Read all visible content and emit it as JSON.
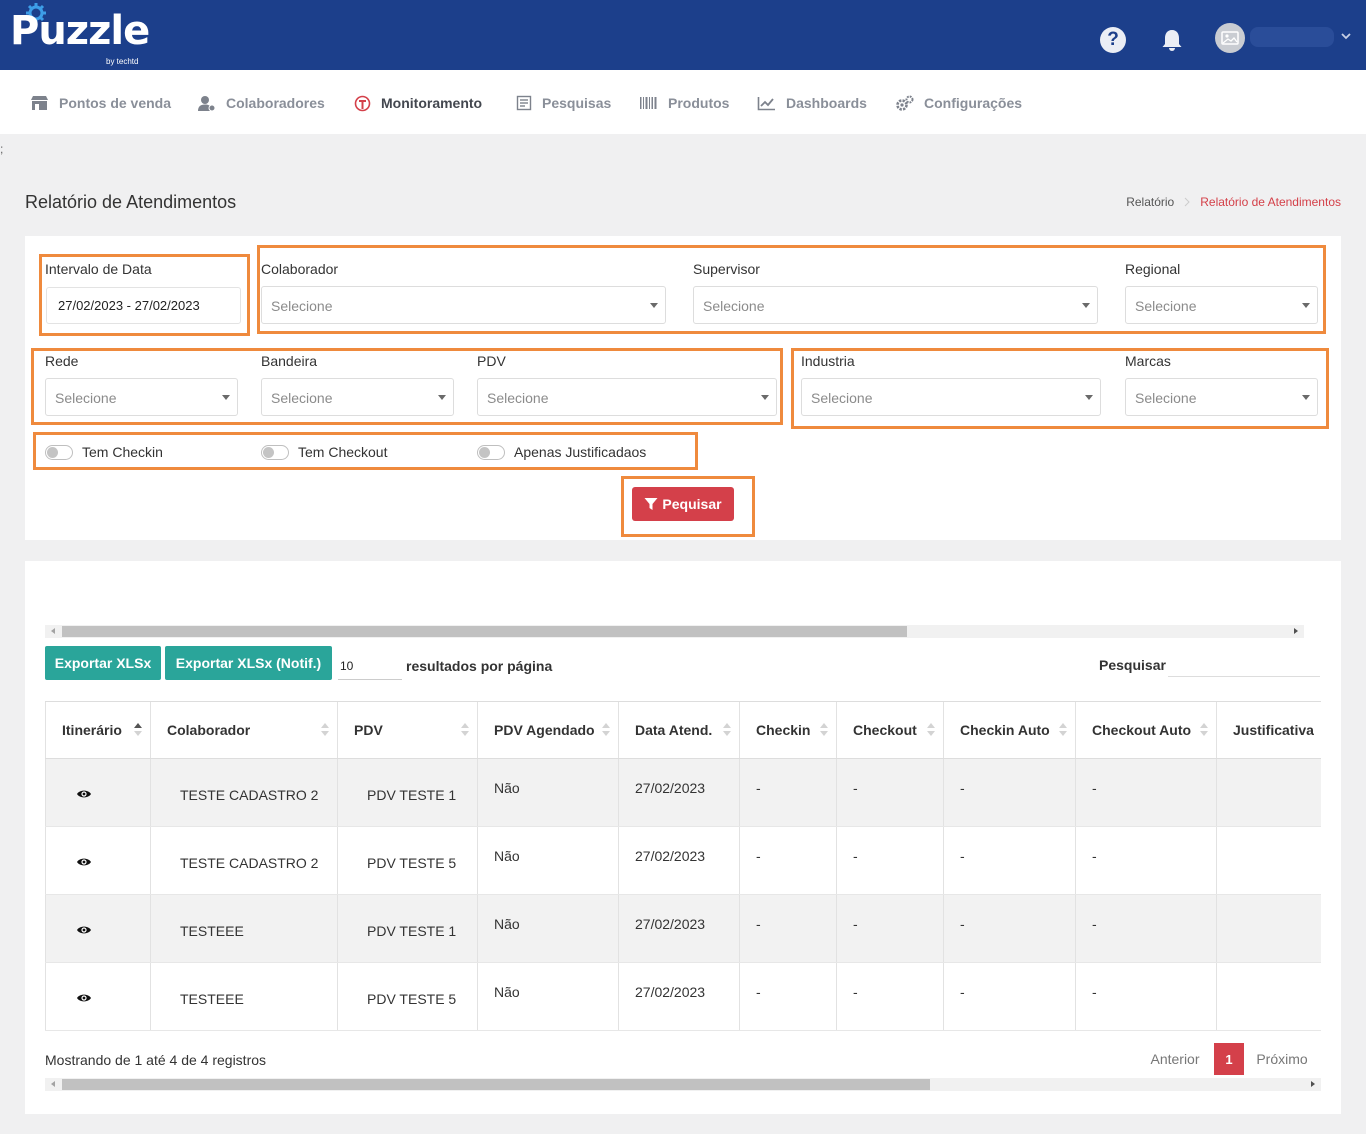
{
  "header": {
    "logo_text": "Puzzle",
    "logo_sub": "by techtd",
    "help_glyph": "?"
  },
  "nav": {
    "items": [
      {
        "label": "Pontos de venda",
        "icon": "store-icon"
      },
      {
        "label": "Colaboradores",
        "icon": "users-gear-icon"
      },
      {
        "label": "Monitoramento",
        "icon": "monitor-pin-icon",
        "active": true
      },
      {
        "label": "Pesquisas",
        "icon": "survey-icon"
      },
      {
        "label": "Produtos",
        "icon": "barcode-icon"
      },
      {
        "label": "Dashboards",
        "icon": "chart-line-icon"
      },
      {
        "label": "Configurações",
        "icon": "gears-icon"
      }
    ]
  },
  "stray_char": ";",
  "page": {
    "title": "Relatório de Atendimentos",
    "breadcrumb": [
      "Relatório",
      "Relatório de Atendimentos"
    ]
  },
  "filters": {
    "date_label": "Intervalo de Data",
    "date_value": "27/02/2023 - 27/02/2023",
    "placeholder": "Selecione",
    "colaborador_label": "Colaborador",
    "supervisor_label": "Supervisor",
    "regional_label": "Regional",
    "rede_label": "Rede",
    "bandeira_label": "Bandeira",
    "pdv_label": "PDV",
    "industria_label": "Industria",
    "marcas_label": "Marcas",
    "toggles": [
      "Tem Checkin",
      "Tem Checkout",
      "Apenas Justificadaos"
    ],
    "search_button": "Pequisar"
  },
  "results": {
    "export_xlsx": "Exportar XLSx",
    "export_xlsx_notif": "Exportar XLSx (Notif.)",
    "page_length": "10",
    "page_length_label": "resultados por página",
    "search_label": "Pesquisar",
    "columns": [
      "Itinerário",
      "Colaborador",
      "PDV",
      "PDV Agendado",
      "Data Atend.",
      "Checkin",
      "Checkout",
      "Checkin Auto",
      "Checkout Auto",
      "Justificativa"
    ],
    "rows": [
      {
        "colaborador": "TESTE CADASTRO 2",
        "pdv": "PDV TESTE 1",
        "agendado": "Não",
        "data": "27/02/2023",
        "checkin": "-",
        "checkout": "-",
        "checkin_auto": "-",
        "checkout_auto": "-",
        "justificativa": ""
      },
      {
        "colaborador": "TESTE CADASTRO 2",
        "pdv": "PDV TESTE 5",
        "agendado": "Não",
        "data": "27/02/2023",
        "checkin": "-",
        "checkout": "-",
        "checkin_auto": "-",
        "checkout_auto": "-",
        "justificativa": ""
      },
      {
        "colaborador": "TESTEEE",
        "pdv": "PDV TESTE 1",
        "agendado": "Não",
        "data": "27/02/2023",
        "checkin": "-",
        "checkout": "-",
        "checkin_auto": "-",
        "checkout_auto": "-",
        "justificativa": ""
      },
      {
        "colaborador": "TESTEEE",
        "pdv": "PDV TESTE 5",
        "agendado": "Não",
        "data": "27/02/2023",
        "checkin": "-",
        "checkout": "-",
        "checkin_auto": "-",
        "checkout_auto": "-",
        "justificativa": ""
      }
    ],
    "info": "Mostrando de 1 até 4 de 4 registros",
    "pagination": {
      "prev": "Anterior",
      "current": "1",
      "next": "Próximo"
    }
  },
  "colors": {
    "header_bg": "#1c3f8b",
    "accent_red": "#d4404a",
    "teal": "#2aa59a",
    "highlight_orange": "#ef8a3d"
  }
}
